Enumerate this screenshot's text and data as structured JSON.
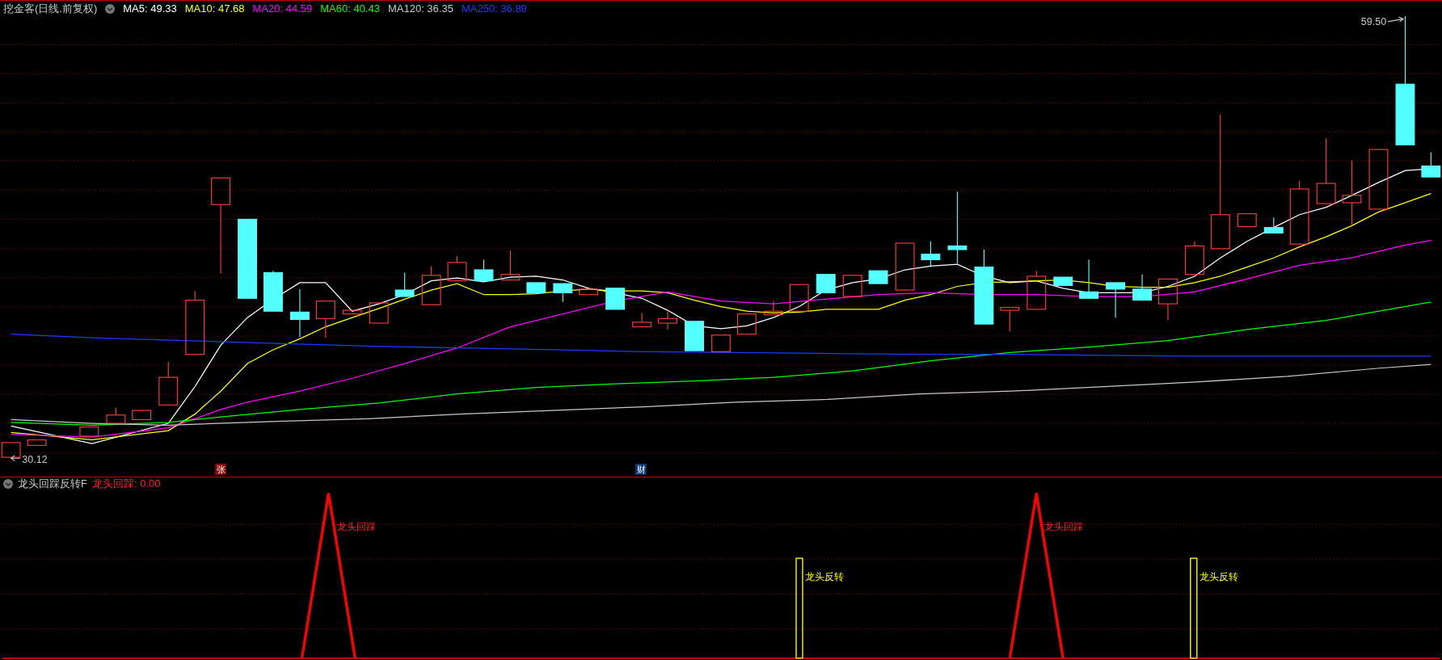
{
  "header": {
    "title": "挖金客(日线.前复权)",
    "moving_averages": [
      {
        "label": "MA5: 49.33",
        "color": "#ffffff"
      },
      {
        "label": "MA10: 47.68",
        "color": "#ffff00"
      },
      {
        "label": "MA20: 44.59",
        "color": "#ff00ff"
      },
      {
        "label": "MA60: 40.43",
        "color": "#00ff00"
      },
      {
        "label": "MA120: 36.35",
        "color": "#c8c8c8"
      },
      {
        "label": "MA250: 36.89",
        "color": "#1a3cff"
      }
    ]
  },
  "price_chart": {
    "high_label": "59.50",
    "low_label": "30.12",
    "event_markers": [
      {
        "kind": "limit",
        "label": "张"
      },
      {
        "kind": "finance",
        "label": "财"
      }
    ]
  },
  "indicator": {
    "name": "龙头回踩反转F",
    "reading": "龙头回踩: 0.00",
    "signals": [
      {
        "kind": "pullback",
        "label": "龙头回踩"
      },
      {
        "kind": "reversal",
        "label": "龙头反转"
      },
      {
        "kind": "pullback",
        "label": "龙头回踩"
      },
      {
        "kind": "reversal",
        "label": "龙头反转"
      }
    ]
  }
}
